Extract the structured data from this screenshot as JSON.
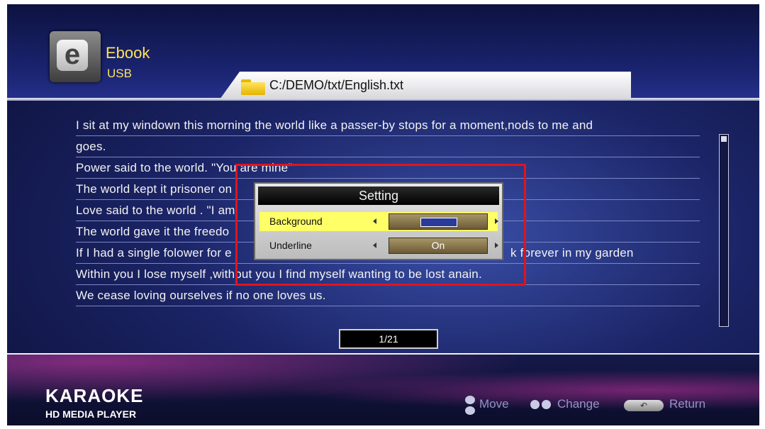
{
  "header": {
    "app_title": "Ebook",
    "app_source": "USB",
    "app_icon_letter": "e",
    "file_path": "C:/DEMO/txt/English.txt"
  },
  "content": {
    "lines": [
      "I sit at my windown this morning the world like a passer-by stops for a moment,nods to me and",
      "goes.",
      "Power said to the world. \"You are mine\"",
      "The world kept it prisoner on",
      "Love said to the world . \"I am",
      "The world gave it the freedo",
      "If I had a single folower for e",
      "Within you I lose myself ,without you I find myself wanting to be lost anain.",
      "We cease loving ourselves if no one loves us."
    ],
    "line6_tail": "k forever in my garden",
    "page_indicator": "1/21"
  },
  "setting_dialog": {
    "title": "Setting",
    "rows": [
      {
        "label": "Background",
        "value": "",
        "swatch_color": "#2a3a9a"
      },
      {
        "label": "Underline",
        "value": "On"
      }
    ]
  },
  "footer": {
    "brand_main": "KARAOKE",
    "brand_sub": "HD MEDIA PLAYER",
    "hints": {
      "move": "Move",
      "change": "Change",
      "return": "Return"
    },
    "return_icon_glyph": "↶"
  },
  "colors": {
    "accent_yellow": "#ffe25a",
    "highlight_row": "#ffff66",
    "annotation_red": "#e0141e"
  }
}
